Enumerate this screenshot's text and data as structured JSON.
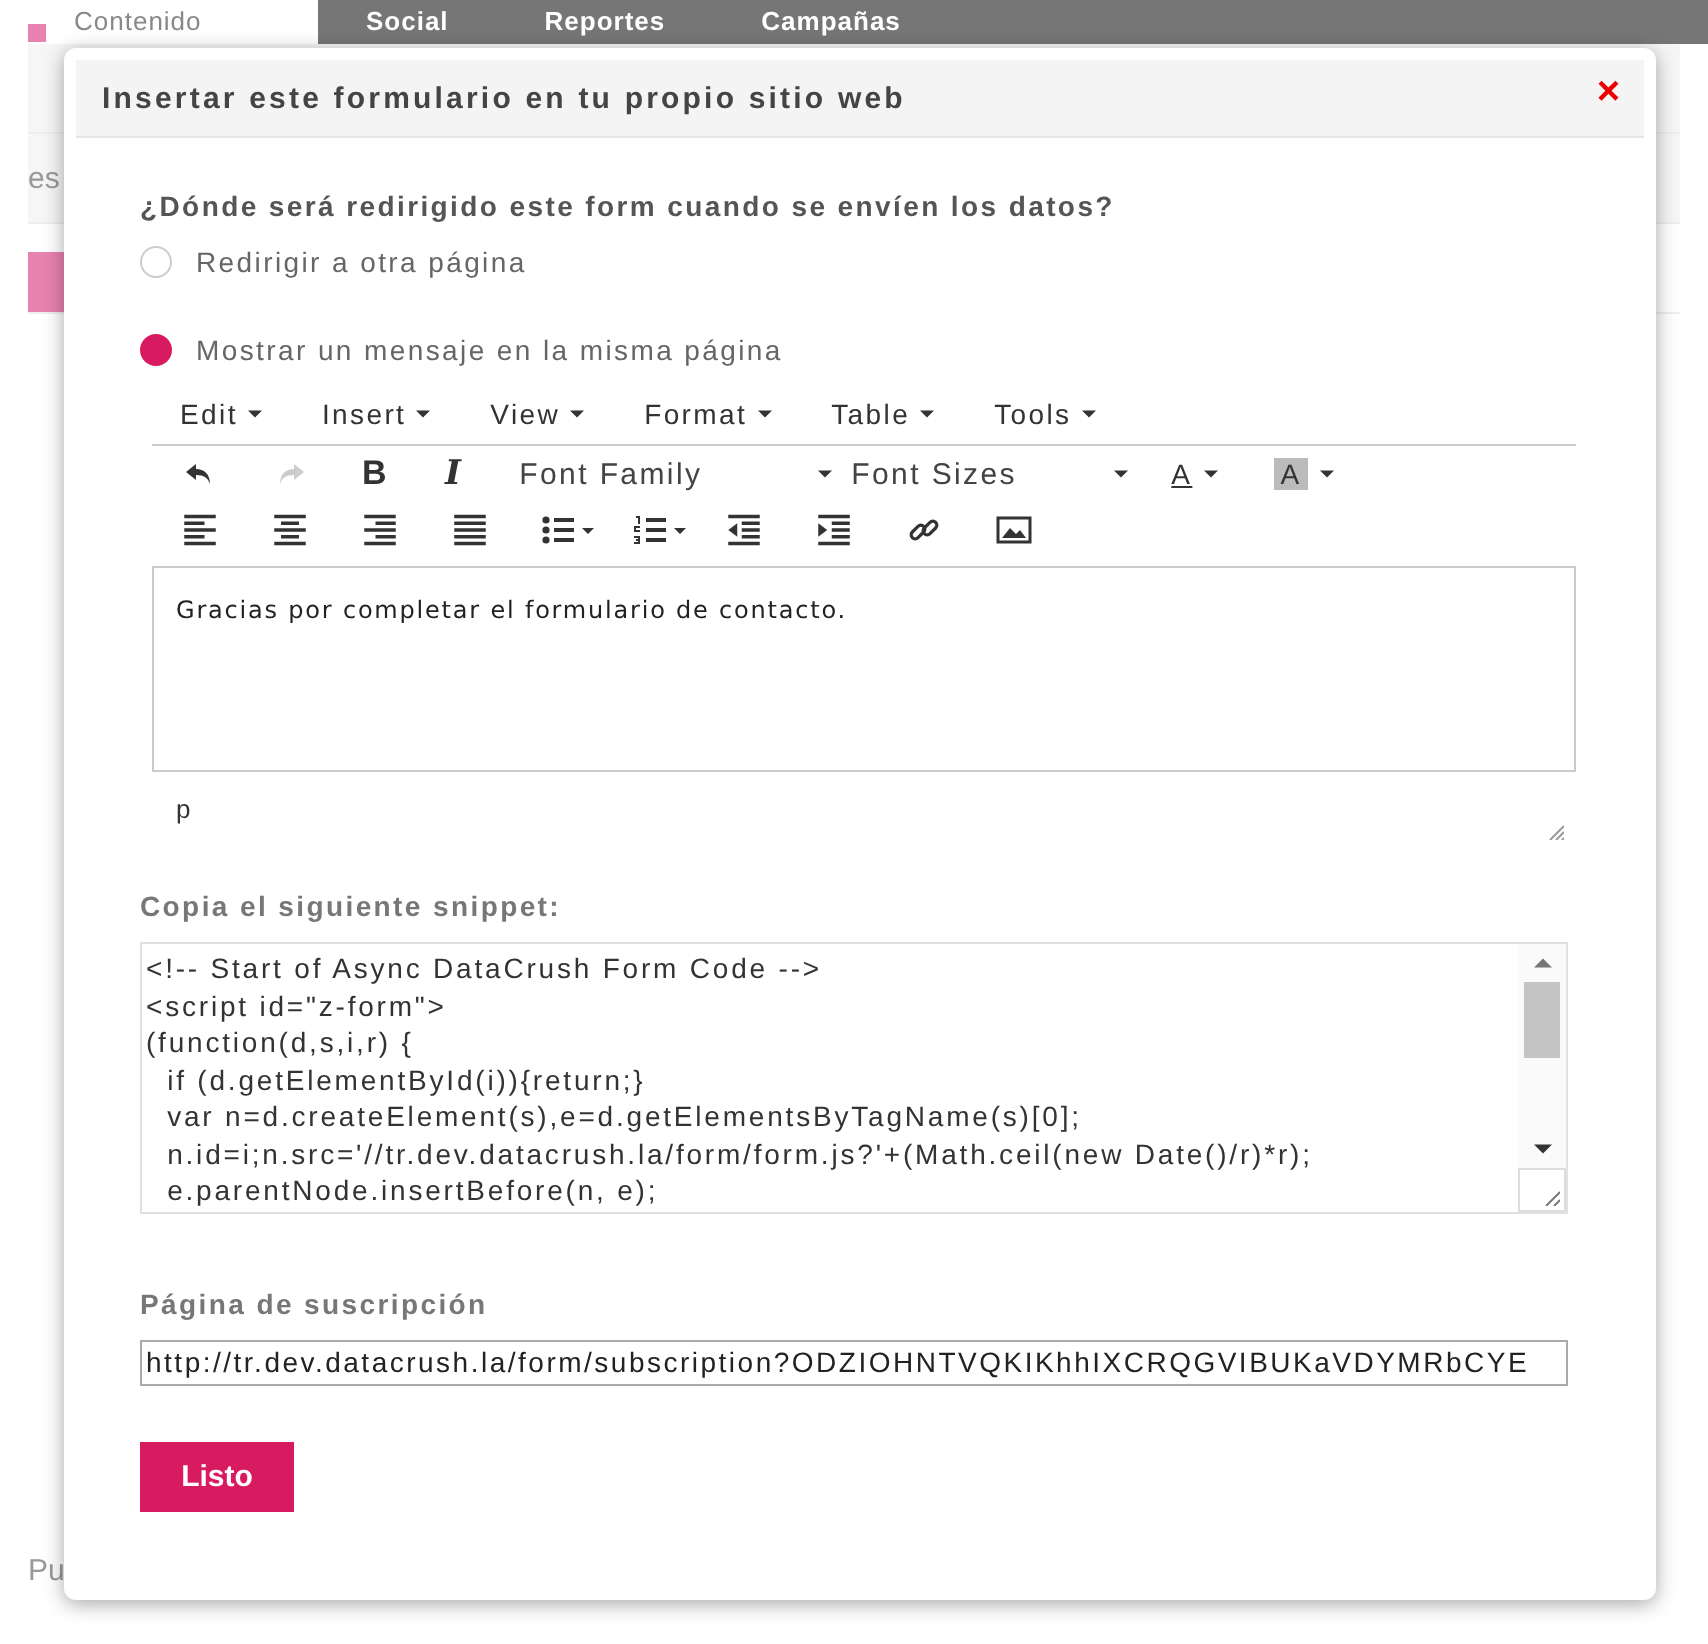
{
  "background": {
    "nav": [
      {
        "label": "Contenido",
        "selected": true
      },
      {
        "label": "Social",
        "selected": false
      },
      {
        "label": "Reportes",
        "selected": false
      },
      {
        "label": "Campañas",
        "selected": false
      }
    ],
    "side_texts": [
      "es",
      "Pu"
    ]
  },
  "dialog": {
    "title": "Insertar este formulario en tu propio sitio web",
    "close": "×",
    "question": "¿Dónde será redirigido este form cuando se envíen los datos?",
    "options": [
      {
        "label": "Redirigir a otra página",
        "selected": false
      },
      {
        "label": "Mostrar un mensaje en la misma página",
        "selected": true
      }
    ],
    "editor": {
      "menus": [
        "Edit",
        "Insert",
        "View",
        "Format",
        "Table",
        "Tools"
      ],
      "bold": "B",
      "italic": "I",
      "font_family": "Font Family",
      "font_sizes": "Font Sizes",
      "text_color": "A",
      "background_color": "A",
      "content": "Gracias por completar el formulario de contacto.",
      "path": "p"
    },
    "snippet_label": "Copia el siguiente snippet:",
    "snippet_lines": [
      "<!-- Start of Async DataCrush Form Code -->",
      "<script id=\"z-form\">",
      "(function(d,s,i,r) {",
      "  if (d.getElementById(i)){return;}",
      "  var n=d.createElement(s),e=d.getElementsByTagName(s)[0];",
      "  n.id=i;n.src='//tr.dev.datacrush.la/form/form.js?'+(Math.ceil(new Date()/r)*r);",
      "  e.parentNode.insertBefore(n, e);"
    ],
    "subscription_label": "Página de suscripción",
    "subscription_url": "http://tr.dev.datacrush.la/form/subscription?ODZIOHNTVQKIKhhIXCRQGVIBUKaVDYMRbCYE",
    "done_button": "Listo"
  }
}
